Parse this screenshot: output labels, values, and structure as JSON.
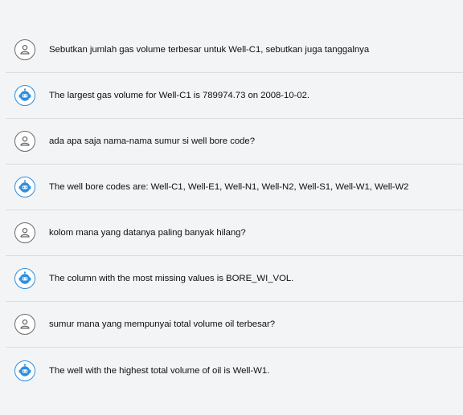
{
  "messages": [
    {
      "role": "user",
      "icon": "user-icon",
      "text": "Sebutkan jumlah gas volume terbesar untuk Well-C1, sebutkan juga tanggalnya"
    },
    {
      "role": "bot",
      "icon": "bot-icon",
      "text": "The largest gas volume for Well-C1 is 789974.73 on 2008-10-02."
    },
    {
      "role": "user",
      "icon": "user-icon",
      "text": "ada apa saja nama-nama sumur si well bore code?"
    },
    {
      "role": "bot",
      "icon": "bot-icon",
      "text": "The well bore codes are: Well-C1, Well-E1, Well-N1, Well-N2, Well-S1, Well-W1, Well-W2"
    },
    {
      "role": "user",
      "icon": "user-icon",
      "text": "kolom mana yang datanya paling banyak hilang?"
    },
    {
      "role": "bot",
      "icon": "bot-icon",
      "text": "The column with the most missing values is BORE_WI_VOL."
    },
    {
      "role": "user",
      "icon": "user-icon",
      "text": "sumur mana yang mempunyai total volume oil terbesar?"
    },
    {
      "role": "bot",
      "icon": "bot-icon",
      "text": "The well with the highest total volume of oil is Well-W1."
    }
  ],
  "colors": {
    "background": "#f3f4f5",
    "user_icon": "#6b6b6b",
    "bot_icon": "#2e8fe0",
    "divider": "#dcdcdc",
    "text": "#111111"
  }
}
